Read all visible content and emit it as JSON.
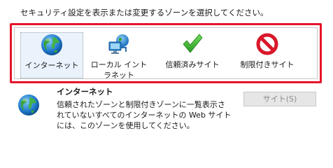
{
  "instruction": "セキュリティ設定を表示または変更するゾーンを選択してください。",
  "zones": [
    {
      "label": "インターネット",
      "icon": "globe-icon",
      "selected": true
    },
    {
      "label": "ローカル イントラネット",
      "icon": "intranet-icon",
      "selected": false
    },
    {
      "label": "信頼済みサイト",
      "icon": "checkmark-icon",
      "selected": false
    },
    {
      "label": "制限付きサイト",
      "icon": "prohibited-icon",
      "selected": false
    }
  ],
  "details": {
    "title": "インターネット",
    "icon": "globe-icon",
    "description": "信頼されたゾーンと制限付きゾーンに一覧表示されていないすべてのインターネットの Web サイトには、このゾーンを使用してください。"
  },
  "sites_button": {
    "label": "サイト(S)",
    "enabled": false
  },
  "colors": {
    "highlight_border": "#e5152a",
    "selected_bg": "#eaf2fb"
  }
}
